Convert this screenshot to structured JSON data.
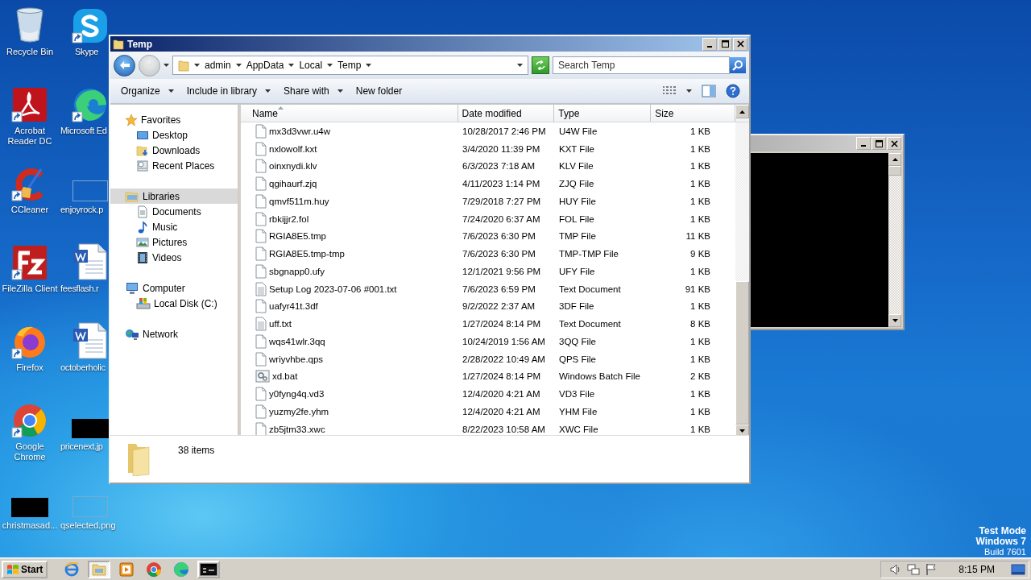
{
  "desktop": {
    "icons": [
      {
        "label": "Recycle Bin",
        "kind": "recycle",
        "shortcut": false
      },
      {
        "label": "Skype",
        "kind": "skype",
        "shortcut": true
      },
      {
        "label": "Acrobat Reader DC",
        "kind": "acrobat",
        "shortcut": true
      },
      {
        "label": "Microsoft Ed",
        "kind": "edge",
        "shortcut": true
      },
      {
        "label": "CCleaner",
        "kind": "ccleaner",
        "shortcut": true
      },
      {
        "label": "enjoyrock.p",
        "kind": "blank-image",
        "shortcut": false
      },
      {
        "label": "FileZilla Client",
        "kind": "filezilla",
        "shortcut": true
      },
      {
        "label": "feesflash.r",
        "kind": "word-doc",
        "shortcut": false
      },
      {
        "label": "Firefox",
        "kind": "firefox",
        "shortcut": true
      },
      {
        "label": "octoberholic",
        "kind": "word-doc",
        "shortcut": false
      },
      {
        "label": "Google Chrome",
        "kind": "chrome",
        "shortcut": true
      },
      {
        "label": "pricenext.jp",
        "kind": "black-image",
        "shortcut": false
      },
      {
        "label": "christmasad...",
        "kind": "black-image",
        "shortcut": false
      },
      {
        "label": "qselected.png",
        "kind": "blank-image",
        "shortcut": false
      }
    ],
    "system_notice": [
      "Test Mode",
      "Windows 7",
      "Build 7601"
    ]
  },
  "explorer": {
    "title": "Temp",
    "breadcrumb": [
      "admin",
      "AppData",
      "Local",
      "Temp"
    ],
    "search": {
      "placeholder": "Search Temp"
    },
    "toolbar": [
      {
        "label": "Organize",
        "menu": true
      },
      {
        "label": "Include in library",
        "menu": true
      },
      {
        "label": "Share with",
        "menu": true
      },
      {
        "label": "New folder",
        "menu": false
      }
    ],
    "nav": [
      {
        "label": "Favorites",
        "kind": "star",
        "selected": false,
        "children": [
          {
            "label": "Desktop",
            "kind": "desktop",
            "selected": false
          },
          {
            "label": "Downloads",
            "kind": "downloads",
            "selected": false
          },
          {
            "label": "Recent Places",
            "kind": "recent",
            "selected": false
          }
        ]
      },
      {
        "label": "Libraries",
        "kind": "library",
        "selected": true,
        "children": [
          {
            "label": "Documents",
            "kind": "documents",
            "selected": false
          },
          {
            "label": "Music",
            "kind": "music",
            "selected": false
          },
          {
            "label": "Pictures",
            "kind": "pictures",
            "selected": false
          },
          {
            "label": "Videos",
            "kind": "videos",
            "selected": false
          }
        ]
      },
      {
        "label": "Computer",
        "kind": "computer",
        "selected": false,
        "children": [
          {
            "label": "Local Disk (C:)",
            "kind": "disk",
            "selected": false
          }
        ]
      },
      {
        "label": "Network",
        "kind": "network",
        "selected": false
      }
    ],
    "columns": [
      {
        "label": "Name",
        "sorted": true
      },
      {
        "label": "Date modified",
        "sorted": false
      },
      {
        "label": "Type",
        "sorted": false
      },
      {
        "label": "Size",
        "sorted": false
      }
    ],
    "rows": [
      {
        "name": "mx3d3vwr.u4w",
        "date": "10/28/2017 2:46 PM",
        "type": "U4W File",
        "size": "1 KB",
        "kind": "file"
      },
      {
        "name": "nxlowolf.kxt",
        "date": "3/4/2020 11:39 PM",
        "type": "KXT File",
        "size": "1 KB",
        "kind": "file"
      },
      {
        "name": "oinxnydi.klv",
        "date": "6/3/2023 7:18 AM",
        "type": "KLV File",
        "size": "1 KB",
        "kind": "file"
      },
      {
        "name": "qgihaurf.zjq",
        "date": "4/11/2023 1:14 PM",
        "type": "ZJQ File",
        "size": "1 KB",
        "kind": "file"
      },
      {
        "name": "qmvf511m.huy",
        "date": "7/29/2018 7:27 PM",
        "type": "HUY File",
        "size": "1 KB",
        "kind": "file"
      },
      {
        "name": "rbkijjr2.fol",
        "date": "7/24/2020 6:37 AM",
        "type": "FOL File",
        "size": "1 KB",
        "kind": "file"
      },
      {
        "name": "RGIA8E5.tmp",
        "date": "7/6/2023 6:30 PM",
        "type": "TMP File",
        "size": "11 KB",
        "kind": "file"
      },
      {
        "name": "RGIA8E5.tmp-tmp",
        "date": "7/6/2023 6:30 PM",
        "type": "TMP-TMP File",
        "size": "9 KB",
        "kind": "file"
      },
      {
        "name": "sbgnapp0.ufy",
        "date": "12/1/2021 9:56 PM",
        "type": "UFY File",
        "size": "1 KB",
        "kind": "file"
      },
      {
        "name": "Setup Log 2023-07-06 #001.txt",
        "date": "7/6/2023 6:59 PM",
        "type": "Text Document",
        "size": "91 KB",
        "kind": "text"
      },
      {
        "name": "uafyr41t.3df",
        "date": "9/2/2022 2:37 AM",
        "type": "3DF File",
        "size": "1 KB",
        "kind": "file"
      },
      {
        "name": "uff.txt",
        "date": "1/27/2024 8:14 PM",
        "type": "Text Document",
        "size": "8 KB",
        "kind": "text"
      },
      {
        "name": "wqs41wlr.3qq",
        "date": "10/24/2019 1:56 AM",
        "type": "3QQ File",
        "size": "1 KB",
        "kind": "file"
      },
      {
        "name": "wriyvhbe.qps",
        "date": "2/28/2022 10:49 AM",
        "type": "QPS File",
        "size": "1 KB",
        "kind": "file"
      },
      {
        "name": "xd.bat",
        "date": "1/27/2024 8:14 PM",
        "type": "Windows Batch File",
        "size": "2 KB",
        "kind": "batch"
      },
      {
        "name": "y0fyng4q.vd3",
        "date": "12/4/2020 4:21 AM",
        "type": "VD3 File",
        "size": "1 KB",
        "kind": "file"
      },
      {
        "name": "yuzmy2fe.yhm",
        "date": "12/4/2020 4:21 AM",
        "type": "YHM File",
        "size": "1 KB",
        "kind": "file"
      },
      {
        "name": "zb5jtm33.xwc",
        "date": "8/22/2023 10:58 AM",
        "type": "XWC File",
        "size": "1 KB",
        "kind": "file"
      }
    ],
    "status": "38 items"
  },
  "taskbar": {
    "start": "Start",
    "apps": [
      {
        "kind": "ie",
        "selected": false,
        "running": false
      },
      {
        "kind": "folder",
        "selected": true,
        "running": true
      },
      {
        "kind": "media",
        "selected": false,
        "running": false
      },
      {
        "kind": "chrome",
        "selected": false,
        "running": false
      },
      {
        "kind": "edge",
        "selected": false,
        "running": false
      },
      {
        "kind": "console",
        "selected": false,
        "running": true
      }
    ],
    "clock": "8:15 PM"
  }
}
